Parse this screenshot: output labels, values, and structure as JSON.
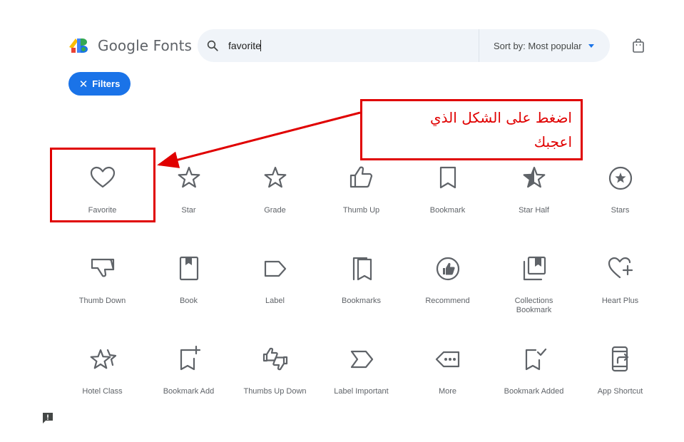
{
  "header": {
    "logo_text": "Google Fonts",
    "search": {
      "value": "favorite"
    },
    "sort_label": "Sort by: Most popular",
    "bag_icon": "shopping-bag-icon"
  },
  "filters": {
    "label": "Filters",
    "icon": "close-icon"
  },
  "callout": {
    "line1": "اضغط على الشكل الذي",
    "line2": "اعجبك"
  },
  "colors": {
    "accent": "#1a73e8",
    "annotation": "#e00000",
    "icon": "#5f6368"
  },
  "icons": [
    {
      "label": "Favorite",
      "icon": "favorite-icon"
    },
    {
      "label": "Star",
      "icon": "star-icon"
    },
    {
      "label": "Grade",
      "icon": "grade-icon"
    },
    {
      "label": "Thumb Up",
      "icon": "thumb-up-icon"
    },
    {
      "label": "Bookmark",
      "icon": "bookmark-icon"
    },
    {
      "label": "Star Half",
      "icon": "star-half-icon"
    },
    {
      "label": "Stars",
      "icon": "stars-icon"
    },
    {
      "label": "Thumb Down",
      "icon": "thumb-down-icon"
    },
    {
      "label": "Book",
      "icon": "book-icon"
    },
    {
      "label": "Label",
      "icon": "label-icon"
    },
    {
      "label": "Bookmarks",
      "icon": "bookmarks-icon"
    },
    {
      "label": "Recommend",
      "icon": "recommend-icon"
    },
    {
      "label": "Collections Bookmark",
      "icon": "collections-bookmark-icon"
    },
    {
      "label": "Heart Plus",
      "icon": "heart-plus-icon"
    },
    {
      "label": "Hotel Class",
      "icon": "hotel-class-icon"
    },
    {
      "label": "Bookmark Add",
      "icon": "bookmark-add-icon"
    },
    {
      "label": "Thumbs Up Down",
      "icon": "thumbs-up-down-icon"
    },
    {
      "label": "Label Important",
      "icon": "label-important-icon"
    },
    {
      "label": "More",
      "icon": "more-icon"
    },
    {
      "label": "Bookmark Added",
      "icon": "bookmark-added-icon"
    },
    {
      "label": "App Shortcut",
      "icon": "app-shortcut-icon"
    }
  ],
  "feedback_icon": "feedback-icon"
}
